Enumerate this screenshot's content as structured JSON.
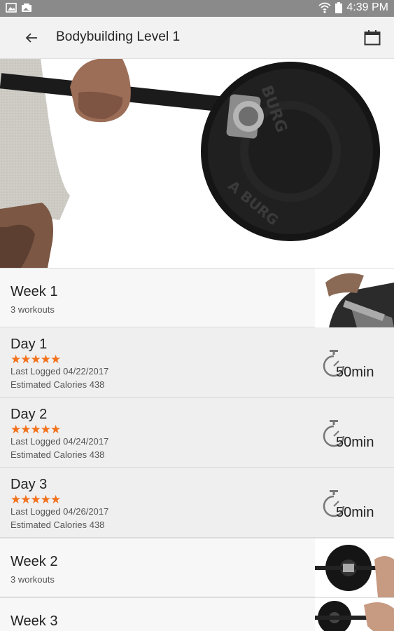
{
  "status_bar": {
    "time": "4:39 PM",
    "icons": [
      "image-icon",
      "gallery-icon",
      "wifi-icon",
      "battery-icon"
    ]
  },
  "toolbar": {
    "title": "Bodybuilding Level 1",
    "back_icon": "arrow-left-icon",
    "calendar_icon": "calendar-icon"
  },
  "hero": {
    "image": "barbell-deadlift-photo"
  },
  "weeks": [
    {
      "title": "Week 1",
      "subtitle": "3 workouts",
      "image": "curl-photo"
    },
    {
      "title": "Week 2",
      "subtitle": "3 workouts",
      "image": "barbell-photo"
    },
    {
      "title": "Week 3",
      "subtitle": "",
      "image": "bench-press-photo"
    }
  ],
  "days": [
    {
      "title": "Day 1",
      "stars": "★★★★★",
      "logged": "Last Logged 04/22/2017",
      "calories": "Estimated Calories 438",
      "duration": "50min"
    },
    {
      "title": "Day 2",
      "stars": "★★★★★",
      "logged": "Last Logged 04/24/2017",
      "calories": "Estimated Calories 438",
      "duration": "50min"
    },
    {
      "title": "Day 3",
      "stars": "★★★★★",
      "logged": "Last Logged 04/26/2017",
      "calories": "Estimated Calories 438",
      "duration": "50min"
    }
  ],
  "colors": {
    "accent_stars": "#f2711c",
    "status_bar": "#8a8a8a",
    "toolbar": "#f2f2f2"
  }
}
